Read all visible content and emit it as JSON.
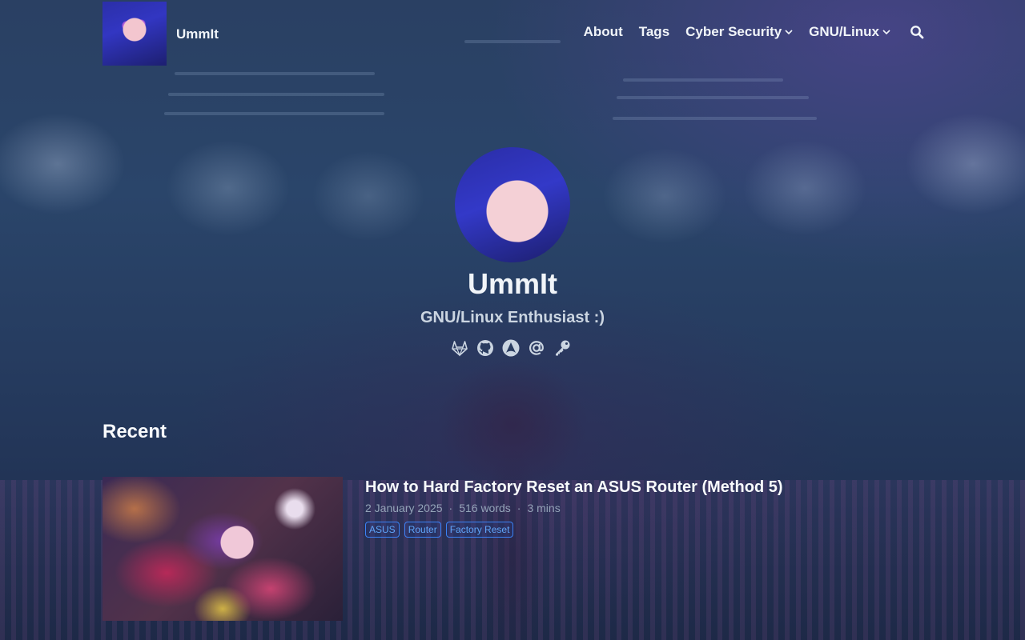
{
  "header": {
    "site_title": "UmmIt",
    "nav": {
      "about": "About",
      "tags": "Tags",
      "cyber_security": "Cyber Security",
      "gnu_linux": "GNU/Linux"
    },
    "icons": [
      "logo-avatar",
      "chevron-down-icon",
      "search-icon"
    ]
  },
  "hero": {
    "name": "UmmIt",
    "subtitle": "GNU/Linux Enthusiast :)",
    "socials": [
      "gitlab-icon",
      "github-icon",
      "arch-linux-icon",
      "email-icon",
      "key-icon"
    ]
  },
  "recent": {
    "heading": "Recent",
    "posts": [
      {
        "title": "How to Hard Factory Reset an ASUS Router (Method 5)",
        "date": "2 January 2025",
        "words": "516 words",
        "reading_time": "3 mins",
        "tags": [
          "ASUS",
          "Router",
          "Factory Reset"
        ]
      }
    ]
  },
  "colors": {
    "accent": "#3b82f6",
    "tag_text": "#60a5fa",
    "text": "#f1f5f9",
    "muted": "#94a3b8"
  }
}
